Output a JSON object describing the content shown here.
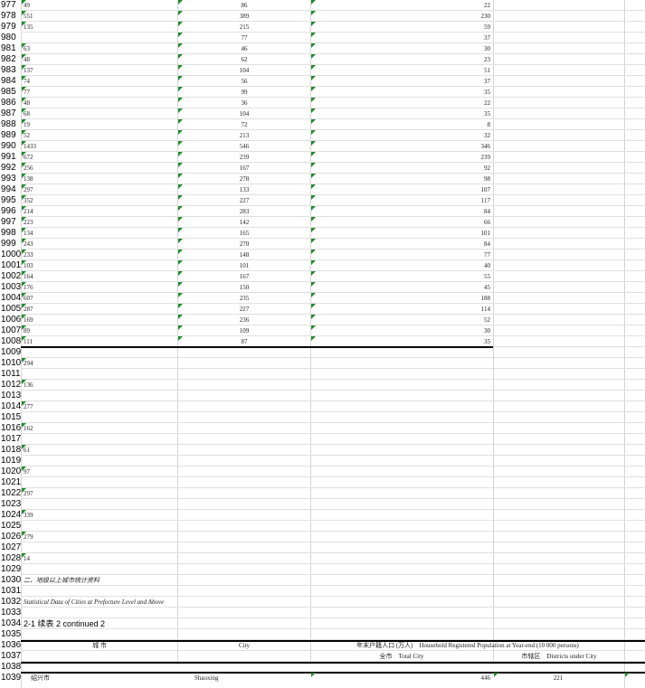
{
  "rows": [
    {
      "n": "977",
      "a": "49",
      "b": "86",
      "c": "22"
    },
    {
      "n": "978",
      "a": "551",
      "b": "389",
      "c": "230"
    },
    {
      "n": "979",
      "a": "135",
      "b": "215",
      "c": "59"
    },
    {
      "n": "980",
      "a": "",
      "b": "77",
      "c": "37"
    },
    {
      "n": "981",
      "a": "63",
      "b": "46",
      "c": "30"
    },
    {
      "n": "982",
      "a": "48",
      "b": "62",
      "c": "23"
    },
    {
      "n": "983",
      "a": "137",
      "b": "104",
      "c": "51"
    },
    {
      "n": "984",
      "a": "74",
      "b": "56",
      "c": "37"
    },
    {
      "n": "985",
      "a": "77",
      "b": "99",
      "c": "35"
    },
    {
      "n": "986",
      "a": "48",
      "b": "36",
      "c": "22"
    },
    {
      "n": "987",
      "a": "68",
      "b": "104",
      "c": "35"
    },
    {
      "n": "988",
      "a": "19",
      "b": "72",
      "c": "8"
    },
    {
      "n": "989",
      "a": "52",
      "b": "213",
      "c": "32"
    },
    {
      "n": "990",
      "a": "1433",
      "b": "546",
      "c": "346"
    },
    {
      "n": "991",
      "a": "672",
      "b": "239",
      "c": "239"
    },
    {
      "n": "992",
      "a": "256",
      "b": "167",
      "c": "92"
    },
    {
      "n": "993",
      "a": "138",
      "b": "278",
      "c": "98"
    },
    {
      "n": "994",
      "a": "297",
      "b": "133",
      "c": "107"
    },
    {
      "n": "995",
      "a": "352",
      "b": "227",
      "c": "117"
    },
    {
      "n": "996",
      "a": "214",
      "b": "283",
      "c": "84"
    },
    {
      "n": "997",
      "a": "223",
      "b": "142",
      "c": "66"
    },
    {
      "n": "998",
      "a": "134",
      "b": "165",
      "c": "101"
    },
    {
      "n": "999",
      "a": "243",
      "b": "270",
      "c": "84"
    },
    {
      "n": "1000",
      "a": "233",
      "b": "148",
      "c": "77"
    },
    {
      "n": "1001",
      "a": "103",
      "b": "101",
      "c": "40"
    },
    {
      "n": "1002",
      "a": "164",
      "b": "167",
      "c": "55"
    },
    {
      "n": "1003",
      "a": "176",
      "b": "150",
      "c": "45"
    },
    {
      "n": "1004",
      "a": "607",
      "b": "235",
      "c": "188"
    },
    {
      "n": "1005",
      "a": "287",
      "b": "227",
      "c": "114"
    },
    {
      "n": "1006",
      "a": "169",
      "b": "236",
      "c": "52"
    },
    {
      "n": "1007",
      "a": "89",
      "b": "109",
      "c": "30"
    },
    {
      "n": "1008",
      "a": "111",
      "b": "87",
      "c": "35"
    }
  ],
  "lower_rows": [
    {
      "n": "1009",
      "a": ""
    },
    {
      "n": "1010",
      "a": "294"
    },
    {
      "n": "1011",
      "a": ""
    },
    {
      "n": "1012",
      "a": "136"
    },
    {
      "n": "1013",
      "a": ""
    },
    {
      "n": "1014",
      "a": "277"
    },
    {
      "n": "1015",
      "a": ""
    },
    {
      "n": "1016",
      "a": "162"
    },
    {
      "n": "1017",
      "a": ""
    },
    {
      "n": "1018",
      "a": "61"
    },
    {
      "n": "1019",
      "a": ""
    },
    {
      "n": "1020",
      "a": "97"
    },
    {
      "n": "1021",
      "a": ""
    },
    {
      "n": "1022",
      "a": "297"
    },
    {
      "n": "1023",
      "a": ""
    },
    {
      "n": "1024",
      "a": "339"
    },
    {
      "n": "1025",
      "a": ""
    },
    {
      "n": "1026",
      "a": "279"
    },
    {
      "n": "1027",
      "a": ""
    },
    {
      "n": "1028",
      "a": "14"
    },
    {
      "n": "1029",
      "a": ""
    }
  ],
  "section_label_cn": "二、地级以上城市统计资料",
  "section_label_en": "Statistical Data of Cities at Prefecture Level and Above",
  "table_title": "2-1 续表 2 continued 2",
  "header": {
    "city_cn": "城 市",
    "city_en": "City",
    "pop_title": "年末户籍人口 (万人)　Household Registered Population at Year-end (10 000 persons)",
    "total_city": "全市　Total City",
    "districts": "市辖区　Districts under City"
  },
  "last_row": {
    "n": "1039",
    "city_cn": "绍兴市",
    "city_en": "Shaoxing",
    "total": "446",
    "districts": "221"
  },
  "row_nums_misc": [
    "1030",
    "1031",
    "1032",
    "1033",
    "1034",
    "1035",
    "1036",
    "1037",
    "1038"
  ],
  "accent_green": "#1f8a2c"
}
